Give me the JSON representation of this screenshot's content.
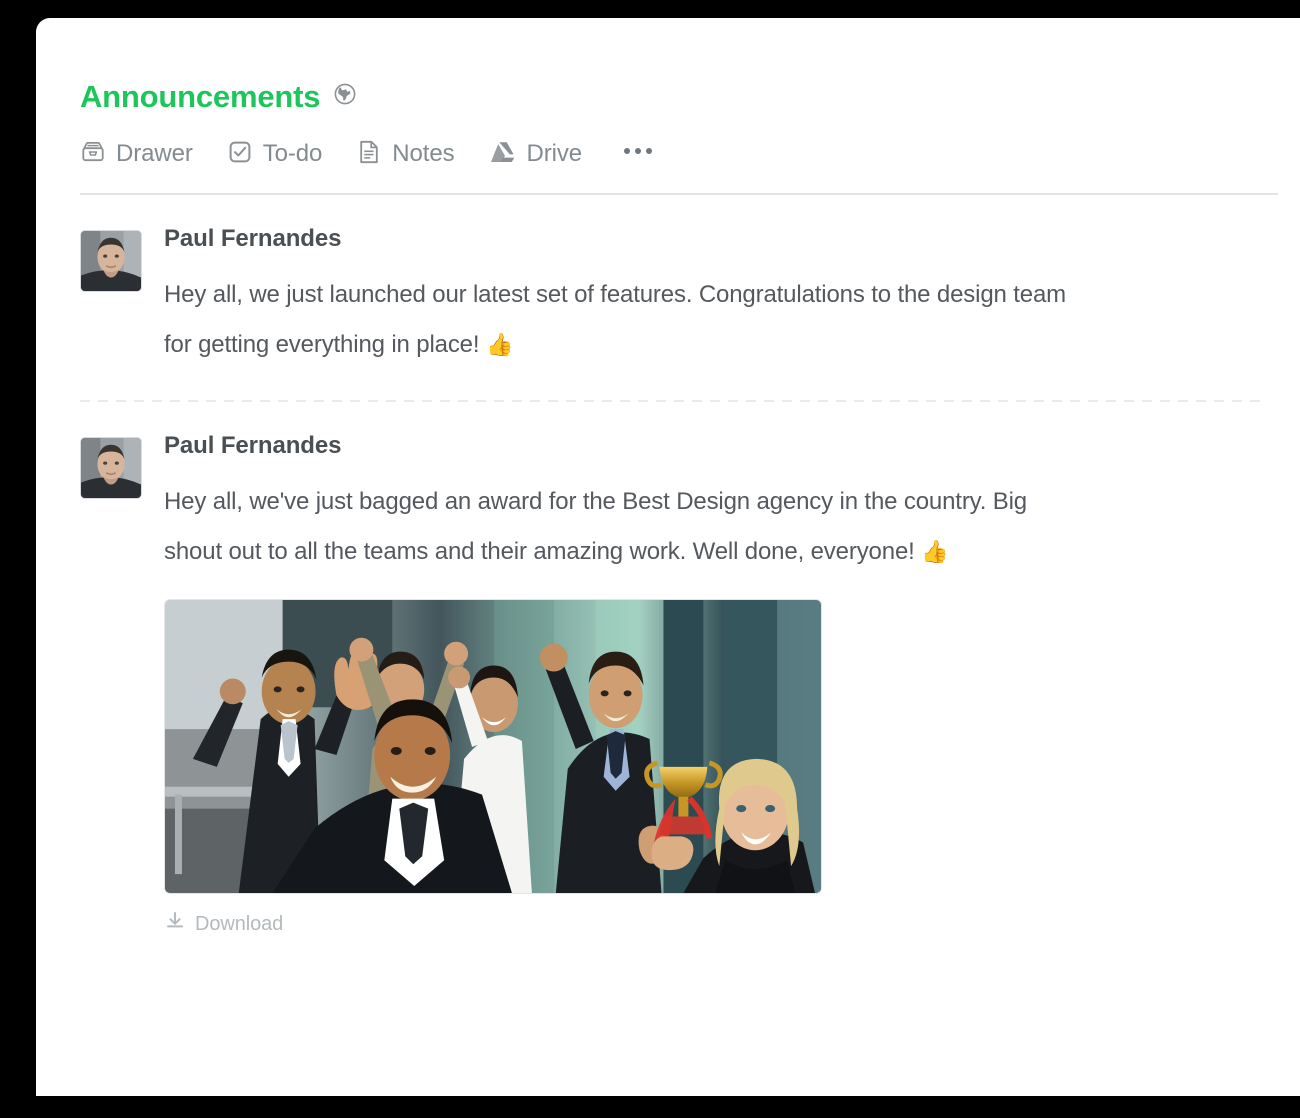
{
  "window": {
    "frame_color": "#000000",
    "card_background": "#ffffff"
  },
  "header": {
    "title": "Announcements",
    "title_color": "#1ec55a",
    "visibility_icon": "globe-icon"
  },
  "toolbar": {
    "items": [
      {
        "label": "Drawer",
        "icon": "drawer-icon"
      },
      {
        "label": "To-do",
        "icon": "checkbox-check-icon"
      },
      {
        "label": "Notes",
        "icon": "document-lines-icon"
      },
      {
        "label": "Drive",
        "icon": "google-drive-icon"
      }
    ],
    "overflow_icon": "ellipsis-icon",
    "icon_color": "#8a9094",
    "label_color": "#838b90"
  },
  "posts": [
    {
      "author": "Paul Fernandes",
      "avatar_icon": "user-photo-avatar",
      "message": "Hey all, we just launched our latest set of features. Congratulations to the design team for getting everything in place!",
      "emoji": "👍",
      "has_attachment": false
    },
    {
      "author": "Paul Fernandes",
      "avatar_icon": "user-photo-avatar",
      "message": "Hey all, we've just bagged an award for the Best Design agency in the country. Big shout out to all the teams and their amazing work. Well done, everyone!",
      "emoji": "👍",
      "has_attachment": true,
      "attachment": {
        "type": "image",
        "alt": "Team celebrating with a gold trophy",
        "download_label": "Download",
        "download_icon": "download-icon"
      }
    }
  ]
}
